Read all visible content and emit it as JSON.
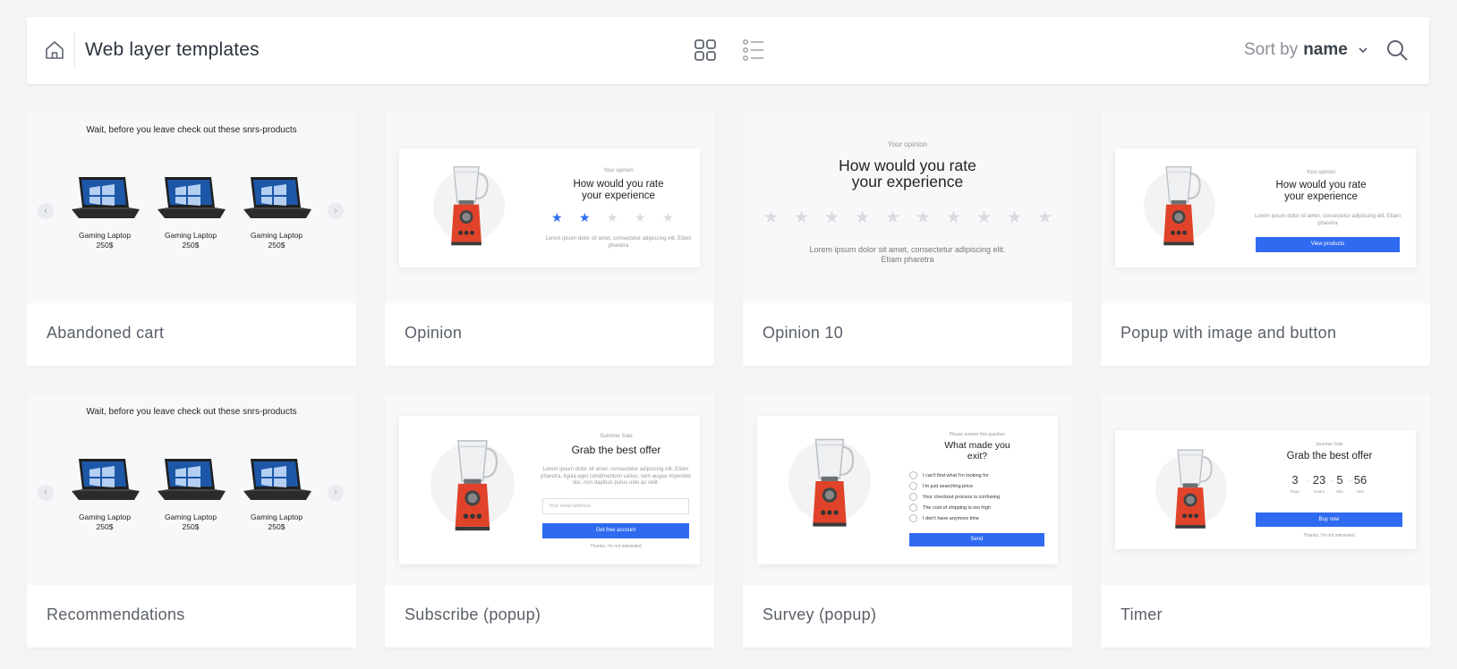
{
  "header": {
    "title": "Web layer templates",
    "sort_prefix": "Sort by",
    "sort_value": "name"
  },
  "cards": [
    {
      "name": "Abandoned cart",
      "preview": {
        "title": "Wait, before you leave check out these snrs-products",
        "products": [
          {
            "name": "Gaming Laptop",
            "price": "250$"
          },
          {
            "name": "Gaming Laptop",
            "price": "250$"
          },
          {
            "name": "Gaming Laptop",
            "price": "250$"
          }
        ]
      }
    },
    {
      "name": "Opinion",
      "preview": {
        "kicker": "Your opinion",
        "headline_1": "How would you rate",
        "headline_2": "your experience",
        "rating": 2,
        "rating_max": 5,
        "body_1": "Lorem ipsum dolor sit amet, consectetur adipiscing elit. Etiam",
        "body_2": "pharetra"
      }
    },
    {
      "name": "Opinion 10",
      "preview": {
        "kicker": "Your opinion",
        "headline_1": "How would you rate",
        "headline_2": "your experience",
        "rating": 0,
        "rating_max": 10,
        "body_1": "Lorem ipsum dolor sit amet, consectetur adipiscing elit.",
        "body_2": "Etiam pharetra"
      }
    },
    {
      "name": "Popup with image and button",
      "preview": {
        "kicker": "Your opinion",
        "headline_1": "How would you rate",
        "headline_2": "your experience",
        "body_1": "Lorem ipsum dolor sit amet, consectetur adipiscing elit. Etiam",
        "body_2": "pharetra",
        "button": "View products"
      }
    },
    {
      "name": "Recommendations",
      "preview": {
        "title": "Wait, before you leave check out these snrs-products",
        "products": [
          {
            "name": "Gaming Laptop",
            "price": "250$"
          },
          {
            "name": "Gaming Laptop",
            "price": "250$"
          },
          {
            "name": "Gaming Laptop",
            "price": "250$"
          }
        ]
      }
    },
    {
      "name": "Subscribe (popup)",
      "preview": {
        "kicker": "Summer Sale",
        "headline": "Grab the best offer",
        "body_1": "Lorem ipsum dolor sit amet, consectetur adipiscing elit. Etiam",
        "body_2": "pharetra, ligula eget condimentum varius, sem augue imperdiet",
        "body_3": "nisi, non dapibus purus odio ac velit.",
        "placeholder": "Your email address",
        "button": "Get free account",
        "decline": "Thanks, I'm not interested"
      }
    },
    {
      "name": "Survey (popup)",
      "preview": {
        "kicker": "Please answer this question",
        "headline_1": "What made you",
        "headline_2": "exit?",
        "options": [
          "I can't find what I'm looking for",
          "I'm just searching price",
          "Your checkout process is confusing",
          "The cost of shipping is too high",
          "I don't have anymore time"
        ],
        "button": "Send"
      }
    },
    {
      "name": "Timer",
      "preview": {
        "kicker": "Summer Sale",
        "headline": "Grab the best offer",
        "timer": [
          {
            "value": "3",
            "unit": "Days"
          },
          {
            "value": "23",
            "unit": "Hours"
          },
          {
            "value": "5",
            "unit": "Min"
          },
          {
            "value": "56",
            "unit": "Sec"
          }
        ],
        "button": "Buy now",
        "decline": "Thanks, I'm not interested"
      }
    }
  ]
}
